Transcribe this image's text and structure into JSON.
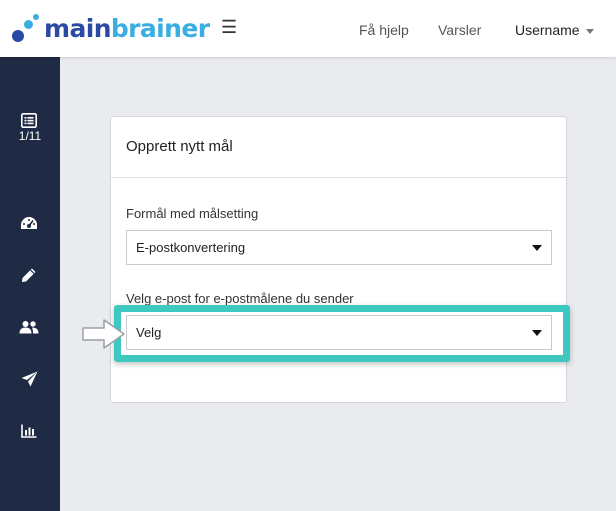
{
  "header": {
    "logo_part1": "main",
    "logo_part2": "brainer",
    "menu_glyph": "☰",
    "help_label": "Få hjelp",
    "alerts_label": "Varsler",
    "user_label": "Username"
  },
  "sidebar": {
    "counter": "1/11",
    "icons": [
      "list-icon",
      "dashboard-icon",
      "pencil-icon",
      "users-icon",
      "send-icon",
      "chart-icon"
    ]
  },
  "card": {
    "title": "Opprett nytt mål",
    "purpose_label": "Formål med målsetting",
    "purpose_value": "E-postkonvertering",
    "email_label": "Velg e-post for e-postmålene du sender",
    "email_value": "Velg"
  },
  "colors": {
    "logo_dark": "#2b4aa6",
    "logo_light": "#3aaee0",
    "sidebar_bg": "#1f2a44",
    "highlight": "#3ec8c0"
  }
}
